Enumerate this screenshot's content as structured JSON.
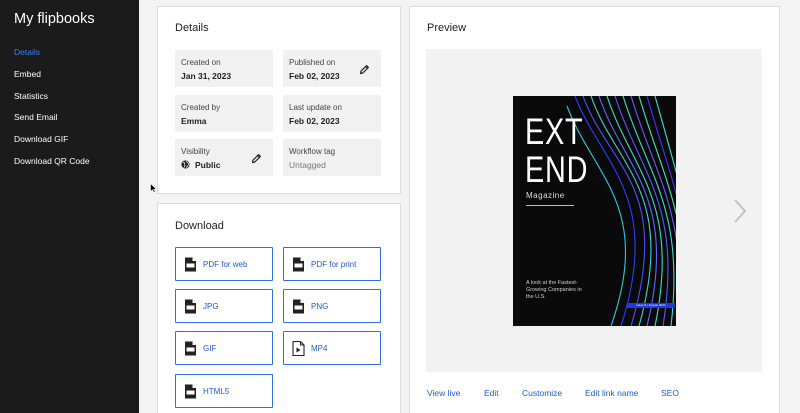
{
  "sidebar": {
    "title": "My flipbooks",
    "items": [
      {
        "label": "Details",
        "active": true
      },
      {
        "label": "Embed"
      },
      {
        "label": "Statistics"
      },
      {
        "label": "Send Email"
      },
      {
        "label": "Download GIF"
      },
      {
        "label": "Download QR Code"
      }
    ]
  },
  "details": {
    "title": "Details",
    "created_on": {
      "label": "Created on",
      "value": "Jan 31, 2023"
    },
    "published_on": {
      "label": "Published on",
      "value": "Feb 02, 2023"
    },
    "created_by": {
      "label": "Created by",
      "value": "Emma"
    },
    "last_update": {
      "label": "Last update on",
      "value": "Feb 02, 2023"
    },
    "visibility": {
      "label": "Visibility",
      "value": "Public"
    },
    "workflow": {
      "label": "Workflow tag",
      "value": "Untagged"
    }
  },
  "download": {
    "title": "Download",
    "buttons": [
      {
        "label": "PDF for web",
        "icon": "pdf-file-icon"
      },
      {
        "label": "PDF for print",
        "icon": "pdf-file-icon"
      },
      {
        "label": "JPG",
        "icon": "jpg-file-icon"
      },
      {
        "label": "PNG",
        "icon": "png-file-icon"
      },
      {
        "label": "GIF",
        "icon": "gif-file-icon"
      },
      {
        "label": "MP4",
        "icon": "mp4-file-icon"
      },
      {
        "label": "HTML5",
        "icon": "html-file-icon"
      }
    ]
  },
  "preview": {
    "title": "Preview",
    "cover": {
      "line1": "EXT",
      "line2": "END",
      "subtitle": "Magazine",
      "tagline": "A look at the Fastest-Growing Companies in the U.S.",
      "issue": "Issue 8 • August 2024"
    },
    "actions": [
      "View live",
      "Edit",
      "Customize",
      "Edit link name",
      "SEO"
    ]
  },
  "colors": {
    "accent": "#1f5ad1",
    "sidebar_bg": "#1b1b1b",
    "active_nav": "#3d7bff"
  }
}
